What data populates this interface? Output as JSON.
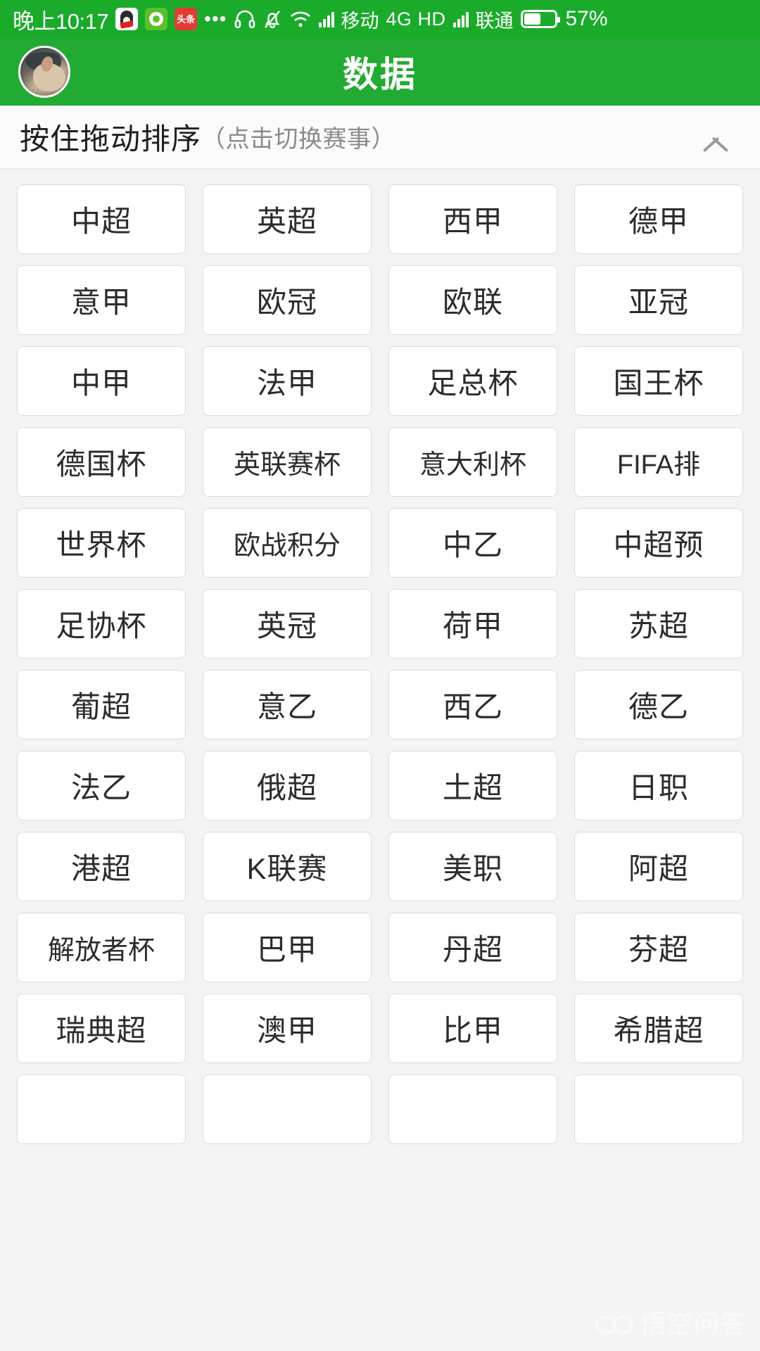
{
  "colors": {
    "brand_green": "#22ab32",
    "status_green": "#1aab2b",
    "page_bg": "#f4f4f4",
    "card_bg": "#ffffff",
    "card_border": "#dcdcdc",
    "text_primary": "#2c2c2c",
    "text_muted": "#8b8b8b"
  },
  "status_bar": {
    "time": "晚上10:17",
    "app_icons": [
      {
        "name": "qq-icon",
        "label": "QQ"
      },
      {
        "name": "green-app-icon",
        "label": "网络"
      },
      {
        "name": "toutiao-icon",
        "label": "头条"
      }
    ],
    "overflow_dots": "•••",
    "icons": [
      {
        "name": "headset-icon",
        "glyph": "⌒"
      },
      {
        "name": "bell-muted-icon",
        "glyph": "🔕"
      },
      {
        "name": "wifi-icon",
        "glyph": "wifi"
      },
      {
        "name": "signal-bars-icon-1",
        "glyph": "bars"
      }
    ],
    "carrier_1": "移动",
    "network_type": "4G HD",
    "carrier_2": "联通",
    "battery_percent": "57%",
    "battery_level": 57
  },
  "header": {
    "title": "数据",
    "avatar_name": "user-avatar"
  },
  "sort_bar": {
    "main_label": "按住拖动排序",
    "sub_label": "（点击切换赛事）",
    "collapse_icon": "chevron-up-icon"
  },
  "watermark": {
    "text": "悟空问答",
    "mark_name": "wukong-logo-icon"
  },
  "leagues": [
    "中超",
    "英超",
    "西甲",
    "德甲",
    "意甲",
    "欧冠",
    "欧联",
    "亚冠",
    "中甲",
    "法甲",
    "足总杯",
    "国王杯",
    "德国杯",
    "英联赛杯",
    "意大利杯",
    "FIFA排",
    "世界杯",
    "欧战积分",
    "中乙",
    "中超预",
    "足协杯",
    "英冠",
    "荷甲",
    "苏超",
    "葡超",
    "意乙",
    "西乙",
    "德乙",
    "法乙",
    "俄超",
    "土超",
    "日职",
    "港超",
    "K联赛",
    "美职",
    "阿超",
    "解放者杯",
    "巴甲",
    "丹超",
    "芬超",
    "瑞典超",
    "澳甲",
    "比甲",
    "希腊超",
    "",
    "",
    "",
    ""
  ]
}
